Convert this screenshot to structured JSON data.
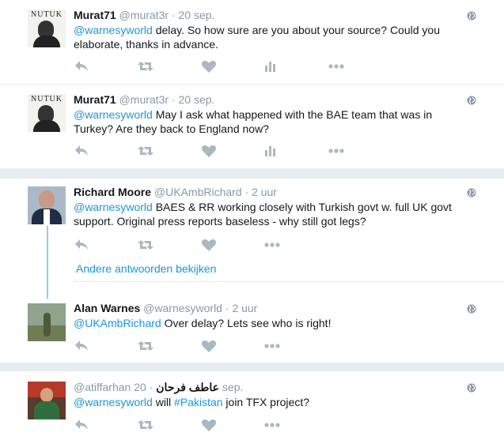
{
  "tweets": [
    {
      "fullname": "Murat71",
      "screen_name": "@murat3r",
      "time": "20 sep.",
      "mention": "@warnesyworld",
      "text": " delay. So how sure are you about your source? Could you elaborate, thanks in advance.",
      "avatar_caption": "NUTUK"
    },
    {
      "fullname": "Murat71",
      "screen_name": "@murat3r",
      "time": "20 sep.",
      "mention": "@warnesyworld",
      "text": " May I ask what happened with the BAE team that was in Turkey? Are they back to England now?",
      "avatar_caption": "NUTUK"
    },
    {
      "fullname": "Richard Moore",
      "screen_name": "@UKAmbRichard",
      "time": "2 uur",
      "mention": "@warnesyworld",
      "text": " BAES & RR working closely with Turkish govt w. full UK govt support. Original press reports baseless - why still got legs?"
    },
    {
      "fullname": "Alan Warnes",
      "screen_name": "@warnesyworld",
      "time": "2 uur",
      "mention": "@UKAmbRichard",
      "text": " Over delay? Lets see who is right!"
    },
    {
      "screen_name": "@atiffarhan",
      "fullname": "عاطف فرحان",
      "time": "20 sep.",
      "mention": "@warnesyworld",
      "text_before": " will ",
      "hashtag": "#Pakistan",
      "text_after": " join TFX project?"
    }
  ],
  "thread": {
    "more_replies": "Andere antwoorden bekijken"
  },
  "separator": "·",
  "icons": {
    "reply": "reply-icon",
    "retweet": "retweet-icon",
    "like": "heart-icon",
    "analytics": "analytics-icon",
    "more": "more-icon",
    "globe": "globe-icon"
  },
  "colors": {
    "link": "#1b95e0",
    "muted": "#8899a6",
    "action_icon": "#aab8c2",
    "thread_line": "#8ed0e8",
    "page_background": "#e6ecf0"
  }
}
